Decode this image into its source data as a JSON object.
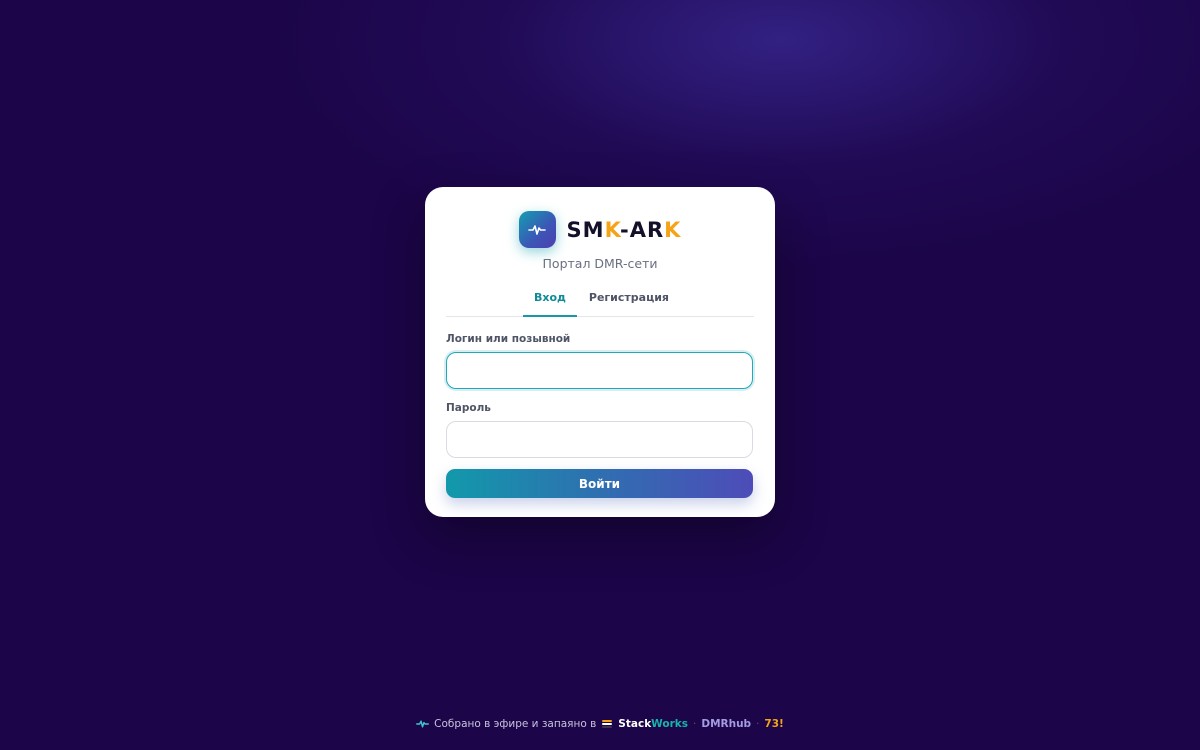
{
  "brand": {
    "name_parts": [
      "SM",
      "K",
      "-AR",
      "K"
    ],
    "subtitle": "Портал DMR-сети",
    "logo_icon": "pulse-icon"
  },
  "tabs": [
    {
      "label": "Вход",
      "active": true
    },
    {
      "label": "Регистрация",
      "active": false
    }
  ],
  "form": {
    "login_label": "Логин или позывной",
    "login_value": "",
    "password_label": "Пароль",
    "password_value": "",
    "submit_label": "Войти"
  },
  "footer": {
    "text": "Собрано в эфире и запаяно в",
    "stack": "Stack",
    "works": "Works",
    "sep1": "·",
    "dmrhub": "DMRhub",
    "sep2": "·",
    "number": "73!"
  },
  "colors": {
    "background": "#1c0548",
    "accent_teal": "#139aa6",
    "accent_orange": "#f5a417",
    "button_gradient_start": "#1299ab",
    "button_gradient_end": "#4e4cb8"
  }
}
